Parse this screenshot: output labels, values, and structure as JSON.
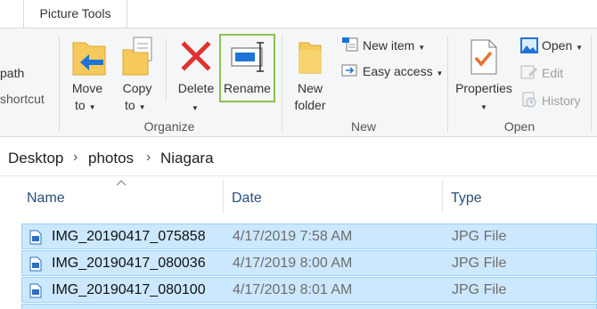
{
  "tabs": {
    "picture_tools": "Picture Tools"
  },
  "ribbon": {
    "clipboard_partial": {
      "copy_path": "path",
      "paste_shortcut": "shortcut"
    },
    "organize": {
      "move_to_line1": "Move",
      "move_to_line2": "to",
      "copy_to_line1": "Copy",
      "copy_to_line2": "to",
      "delete": "Delete",
      "rename": "Rename",
      "group_label": "Organize"
    },
    "new": {
      "new_folder_line1": "New",
      "new_folder_line2": "folder",
      "new_item": "New item",
      "easy_access": "Easy access",
      "group_label": "New"
    },
    "open": {
      "properties": "Properties",
      "open": "Open",
      "edit": "Edit",
      "history": "History",
      "group_label": "Open"
    }
  },
  "address": {
    "crumbs": [
      "Desktop",
      "photos",
      "Niagara"
    ]
  },
  "columns": {
    "name": "Name",
    "date": "Date",
    "type": "Type"
  },
  "files": [
    {
      "name": "IMG_20190417_075858",
      "date": "4/17/2019 7:58 AM",
      "type": "JPG File",
      "selected": true
    },
    {
      "name": "IMG_20190417_080036",
      "date": "4/17/2019 8:00 AM",
      "type": "JPG File",
      "selected": true
    },
    {
      "name": "IMG_20190417_080100",
      "date": "4/17/2019 8:01 AM",
      "type": "JPG File",
      "selected": true
    }
  ],
  "colors": {
    "selection_fill": "#cce8ff",
    "selection_border": "#99d1ff",
    "rename_highlight": "#8cc152",
    "delete_red": "#e03131",
    "arrow_blue": "#1e73d6",
    "folder_yellow": "#f5c95c"
  },
  "icons": {
    "move_to": "move-to-icon",
    "copy_to": "copy-to-icon",
    "delete": "delete-x-icon",
    "rename": "rename-icon",
    "new_folder": "folder-icon",
    "new_item": "new-item-icon",
    "easy_access": "easy-access-icon",
    "properties": "properties-check-icon",
    "open": "open-image-icon",
    "edit": "edit-icon",
    "history": "history-icon",
    "file": "jpg-file-icon"
  }
}
